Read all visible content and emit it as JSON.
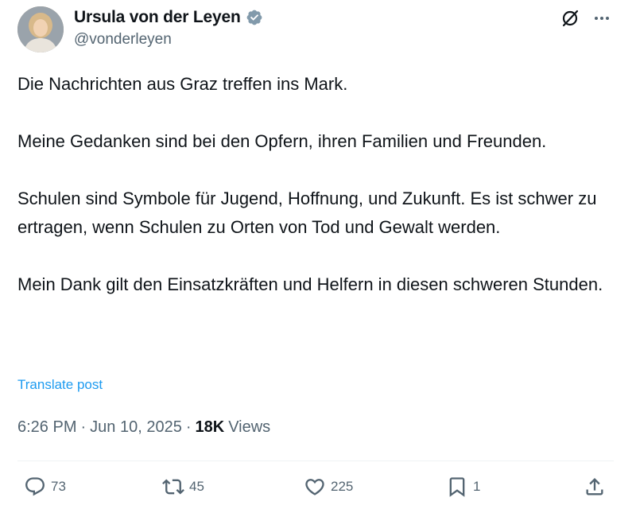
{
  "author": {
    "display_name": "Ursula von der Leyen",
    "handle": "@vonderleyen",
    "verified": true,
    "verified_color": "#829aab"
  },
  "header_icons": [
    "grok-icon",
    "more-icon"
  ],
  "tweet": {
    "paragraphs": [
      "Die Nachrichten aus Graz treffen ins Mark.",
      "Meine Gedanken sind bei den Opfern, ihren Familien und Freunden.",
      "Schulen sind Symbole für Jugend, Hoffnung, und Zukunft. Es ist schwer zu ertragen, wenn Schulen zu Orten von Tod und Gewalt werden.",
      "Mein Dank gilt den Einsatzkräften und Helfern in diesen schweren Stunden."
    ],
    "translate_label": "Translate post"
  },
  "meta": {
    "time": "6:26 PM",
    "separator": "·",
    "date": "Jun 10, 2025",
    "views_count": "18K",
    "views_label": "Views"
  },
  "actions": {
    "replies": "73",
    "reposts": "45",
    "likes": "225",
    "bookmarks": "1"
  },
  "colors": {
    "text": "#0f1419",
    "secondary": "#536471",
    "link": "#1d9bf0",
    "divider": "#eff3f4"
  }
}
